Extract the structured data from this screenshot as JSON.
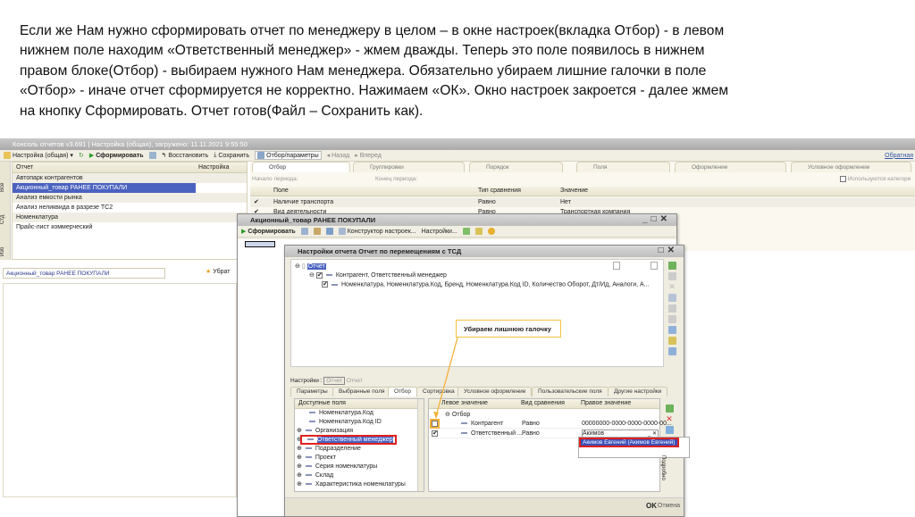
{
  "slide": {
    "lines": [
      "Если же Нам нужно сформировать отчет по менеджеру в целом – в окне настроек(вкладка Отбор)  - в левом",
      "нижнем поле находим «Ответственный менеджер» - жмем дважды. Теперь это поле появилось в нижнем",
      "правом блоке(Отбор)  - выбираем нужного Нам менеджера. Обязательно убираем лишние галочки в поле",
      "«Отбор»  - иначе отчет сформируется не корректно. Нажимаем «ОК». Окно настроек закроется  - далее жмем",
      "на кнопку Сформировать. Отчет готов(Файл – Сохранить как)."
    ]
  },
  "app": {
    "title": "Консоль отчетов v3.691 | Настройка (общая), загружено: 11.11.2021 9:55:50",
    "toolbar": {
      "settings": "Настройка (общая)",
      "generate": "Сформировать",
      "restore": "Восстановить",
      "save": "Сохранить",
      "filter_params": "Отбор/параметры",
      "back": "Назад",
      "forward": "Вперед",
      "feedback": "Обратная"
    },
    "side_tabs": [
      "Все",
      "Стд",
      "Изб"
    ],
    "report_list": {
      "col_report": "Отчет",
      "col_setting": "Настройка",
      "items": [
        "Автопарк контрагентов",
        "Акционный_товар РАНЕЕ ПОКУПАЛИ",
        "Анализ емкости рынка",
        "Анализ неликвида в разрезе ТС2",
        "Номенклатура",
        "Прайс-лист коммерческий"
      ],
      "selected_index": 1
    },
    "current_report": "Акционный_товар РАНЕЕ ПОКУПАЛИ",
    "remove_favorite": "Убрат",
    "right_tabs": [
      "Отбор",
      "Группировки",
      "Порядок",
      "Поля",
      "Оформление",
      "Условное оформление"
    ],
    "period_start": "Начало периода:",
    "period_end": "Конец периода:",
    "use_categories": "Используются категори",
    "filter_table": {
      "headers": [
        "Поле",
        "Тип сравнения",
        "Значение"
      ],
      "rows": [
        [
          "Наличие транспорта",
          "Равно",
          "Нет"
        ],
        [
          "Вид деятельности",
          "Равно",
          "Транспортная компания"
        ]
      ]
    }
  },
  "dialog_report": {
    "title": "Акционный_товар РАНЕЕ ПОКУПАЛИ",
    "generate": "Сформировать",
    "constructor": "Конструктор настроек...",
    "settings": "Настройки..."
  },
  "dialog_settings": {
    "title": "Настройки отчета  Отчет по перемещениям с ТСД",
    "tree": {
      "root": "Отчет",
      "level1": "Контрагент, Ответственный менеджер",
      "level2": "Номенклатура, Номенклатура.Код, Бренд, Номенклатура.Код ID, Количество Оборот, Дт/Ид, Аналоги, А..."
    },
    "settings_label": "Настройки :",
    "settings_value": "Отчет",
    "settings_value2": "Отчет",
    "tabs": [
      "Параметры",
      "Выбранные поля",
      "Отбор",
      "Сортировка",
      "Условное оформление",
      "Пользовательские поля",
      "Другие настройки"
    ],
    "active_tab": "Отбор",
    "available_fields": {
      "header": "Доступные поля",
      "items": [
        "Номенклатура.Код",
        "Номенклатура.Код ID",
        "Организация",
        "Ответственный менеджер",
        "Подразделение",
        "Проект",
        "Серия номенклатуры",
        "Склад",
        "Характеристика номенклатуры"
      ],
      "selected_index": 3
    },
    "filter": {
      "headers": [
        "Левое значение",
        "Вид сравнения",
        "Правое значение"
      ],
      "group": "Отбор",
      "rows": [
        {
          "checked": false,
          "left": "Контрагент",
          "comparison": "Равно",
          "right": "00000000-0000-0000-0000-00..."
        },
        {
          "checked": true,
          "left": "Ответственный ...",
          "comparison": "Равно",
          "right": "Акимов"
        }
      ],
      "dropdown_option": "Акимов Евгений (Акимов Евгений)"
    },
    "details": "Подробно",
    "ok": "OK",
    "cancel": "Отмена"
  },
  "callout": "Убираем лишнюю галочку",
  "colors": {
    "selection": "#4a62c0",
    "highlight_red": "#e0201e",
    "callout_border": "#f5c242"
  }
}
